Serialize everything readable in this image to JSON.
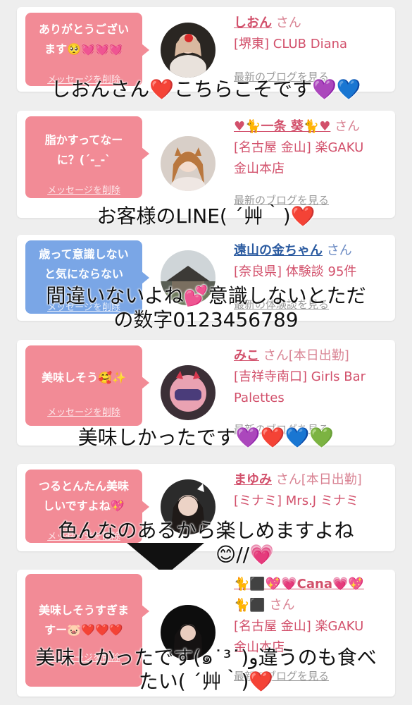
{
  "cards": [
    {
      "bubble": [
        "ありがとうござい",
        "ます🥺💓💓💓"
      ],
      "delete_label": "メッセージを削除",
      "name": "しおん",
      "san": "さん",
      "shop": [
        "[堺東] CLUB Diana"
      ],
      "blog": "最新のブログを見る",
      "caption": "しおんさん❤️こちらこそです💜💙"
    },
    {
      "bubble": [
        "脂かすってなー",
        "に？(´-_-`"
      ],
      "delete_label": "メッセージを削除",
      "name": "♥🐈一条 葵🐈♥",
      "san": "さん",
      "shop": [
        "[名古屋 金山] 楽GAKU",
        "金山本店"
      ],
      "blog": "最新のブログを見る",
      "caption": "お客様のLINE( ´艸｀)❤️"
    },
    {
      "bubble": [
        "歳って意識しない",
        "と気にならない"
      ],
      "delete_label": "メッセージを削除",
      "name": "遠山の金ちゃん",
      "san": "さん",
      "shop": [
        "[奈良県] 体験談 95件"
      ],
      "blog": "最新の体験談を見る",
      "caption": [
        "間違いないよね💕意識しないとただ",
        "の数字0123456789"
      ]
    },
    {
      "bubble": [
        "美味しそう🥰✨"
      ],
      "delete_label": "メッセージを削除",
      "name": "みこ",
      "san": "さん[本日出勤]",
      "shop": [
        "[吉祥寺南口] Girls Bar",
        "Palettes"
      ],
      "blog": "最新のブログを見る",
      "caption": "美味しかったです💜❤️💙💚"
    },
    {
      "bubble": [
        "つるとんたん美味",
        "しいですよね💖"
      ],
      "delete_label": "メッセージを削除",
      "name": "まゆみ",
      "san": "さん[本日出勤]",
      "shop": [
        "[ミナミ] Mrs.J ミナミ"
      ],
      "blog": "最新のブログを見る",
      "caption": [
        "色んなのあるから楽しめますよね",
        "😊//💗"
      ]
    },
    {
      "bubble": [
        "美味しそうすぎま",
        "すー🐷❤️❤️❤️"
      ],
      "delete_label": "メッセージを削除",
      "name": "🐈⬛💖💗Cana💗💖",
      "name2": "🐈⬛",
      "san": "さん",
      "shop": [
        "[名古屋 金山] 楽GAKU",
        "金山本店"
      ],
      "blog": "最新のブログを見る",
      "caption": [
        "美味しかったです(๑˙³˙)و違うのも食べ",
        "たい( ´艸｀)❤️"
      ]
    }
  ],
  "colors": {
    "bubble_pink": "#f28b96",
    "bubble_blue": "#7aa6e6",
    "link_pink": "#d2506b",
    "link_blue": "#2a5aa0"
  },
  "icons": [
    "avatar-photo"
  ]
}
